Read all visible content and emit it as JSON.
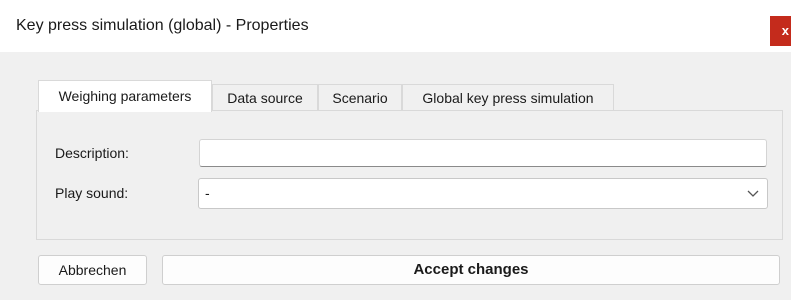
{
  "window": {
    "title": "Key press simulation (global) - Properties",
    "close_glyph": "x"
  },
  "tabs": [
    {
      "label": "Weighing parameters",
      "active": true
    },
    {
      "label": "Data source",
      "active": false
    },
    {
      "label": "Scenario",
      "active": false
    },
    {
      "label": "Global key press simulation",
      "active": false
    }
  ],
  "form": {
    "description_label": "Description:",
    "description_value": "",
    "play_sound_label": "Play sound:",
    "play_sound_value": "-"
  },
  "buttons": {
    "cancel_label": "Abbrechen",
    "accept_label": "Accept changes"
  },
  "colors": {
    "close_button": "#c42b1c",
    "window_background": "#f0f0f0",
    "titlebar_background": "#ffffff"
  }
}
